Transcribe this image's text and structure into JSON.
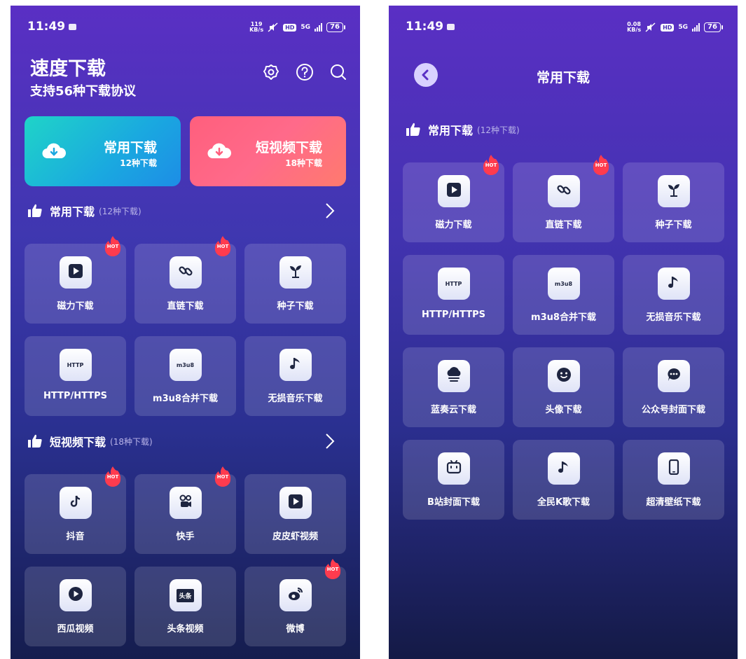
{
  "status": {
    "time": "11:49",
    "battery": "76",
    "network": "5G",
    "hd": "HD",
    "speed_left": [
      "119",
      "KB/s"
    ],
    "speed_right": [
      "0.08",
      "KB/s"
    ]
  },
  "left": {
    "title": "速度下载",
    "subtitle": "支持56种下载协议",
    "header_icons": [
      "settings-icon",
      "help-icon",
      "search-icon"
    ],
    "cards": [
      {
        "title": "常用下载",
        "sub": "12种下载"
      },
      {
        "title": "短视频下载",
        "sub": "18种下载"
      }
    ],
    "section_common": {
      "name": "常用下载",
      "count": "(12种下载)"
    },
    "section_short": {
      "name": "短视频下载",
      "count": "(18种下载)"
    },
    "common_items": [
      {
        "label": "磁力下载",
        "icon": "play-icon",
        "hot": true
      },
      {
        "label": "直链下载",
        "icon": "link-icon",
        "hot": true
      },
      {
        "label": "种子下载",
        "icon": "sprout-icon",
        "hot": false
      },
      {
        "label": "HTTP/HTTPS",
        "icon": "http-icon",
        "icon_text": "HTTP",
        "hot": false
      },
      {
        "label": "m3u8合并下载",
        "icon": "m3u8-icon",
        "icon_text": "m3u8",
        "hot": false
      },
      {
        "label": "无损音乐下载",
        "icon": "music-note-icon",
        "hot": false
      }
    ],
    "short_items": [
      {
        "label": "抖音",
        "icon": "tiktok-icon",
        "hot": true
      },
      {
        "label": "快手",
        "icon": "kuaishou-icon",
        "hot": true
      },
      {
        "label": "皮皮虾视频",
        "icon": "play-icon",
        "hot": false
      },
      {
        "label": "西瓜视频",
        "icon": "play-circle-icon",
        "hot": false
      },
      {
        "label": "头条视频",
        "icon": "toutiao-icon",
        "icon_text": "头条",
        "hot": false
      },
      {
        "label": "微博",
        "icon": "weibo-icon",
        "hot": true
      }
    ],
    "hot_label": "HOT"
  },
  "right": {
    "title": "常用下载",
    "section": {
      "name": "常用下载",
      "count": "(12种下载)"
    },
    "items": [
      {
        "label": "磁力下载",
        "icon": "play-icon",
        "hot": true
      },
      {
        "label": "直链下载",
        "icon": "link-icon",
        "hot": true
      },
      {
        "label": "种子下载",
        "icon": "sprout-icon",
        "hot": false
      },
      {
        "label": "HTTP/HTTPS",
        "icon": "http-icon",
        "icon_text": "HTTP",
        "hot": false
      },
      {
        "label": "m3u8合并下载",
        "icon": "m3u8-icon",
        "icon_text": "m3u8",
        "hot": false
      },
      {
        "label": "无损音乐下载",
        "icon": "music-note-icon",
        "hot": false
      },
      {
        "label": "蓝奏云下载",
        "icon": "cloud-icon",
        "hot": false
      },
      {
        "label": "头像下载",
        "icon": "smile-icon",
        "hot": false
      },
      {
        "label": "公众号封面下载",
        "icon": "chat-icon",
        "hot": false
      },
      {
        "label": "B站封面下载",
        "icon": "bilibili-icon",
        "hot": false
      },
      {
        "label": "全民K歌下载",
        "icon": "music-note-icon",
        "hot": false
      },
      {
        "label": "超清壁纸下载",
        "icon": "phone-icon",
        "hot": false
      }
    ]
  },
  "colors": {
    "accent_purple": "#5a2fc4",
    "teal_card": "#1fd4c8",
    "pink_card": "#ff5f7d",
    "hot_red": "#ff3b4e"
  }
}
